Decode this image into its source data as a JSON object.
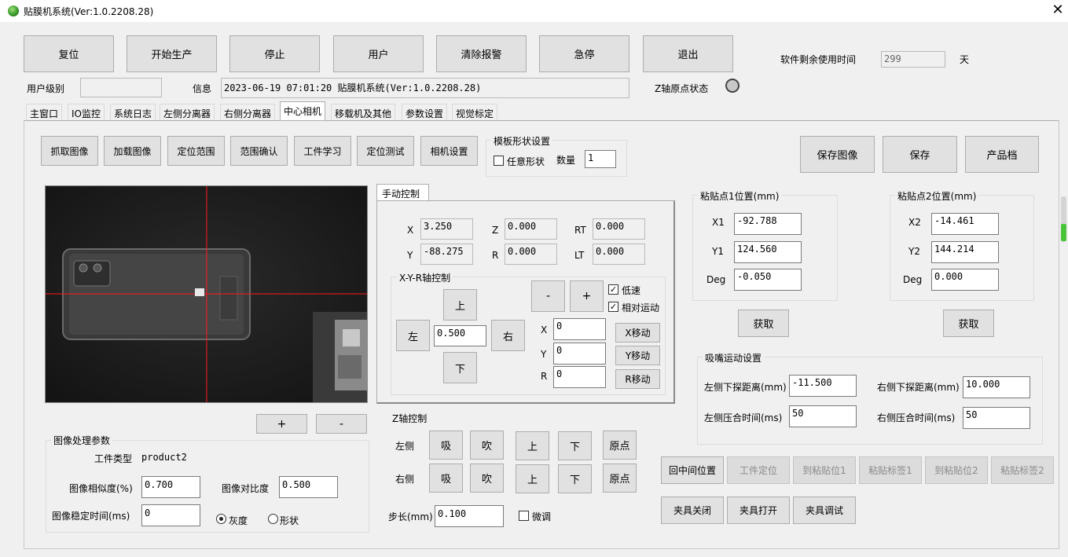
{
  "window": {
    "title": "贴膜机系统(Ver:1.0.2208.28)",
    "close": "✕"
  },
  "toolbar": {
    "buttons": [
      "复位",
      "开始生产",
      "停止",
      "用户",
      "清除报警",
      "急停",
      "退出"
    ],
    "remaining_label": "软件剩余使用时间",
    "remaining_value": "299",
    "remaining_unit": "天"
  },
  "status": {
    "user_level_label": "用户级别",
    "user_level_value": "",
    "info_label": "信息",
    "info_value": "2023-06-19 07:01:20 贴膜机系统(Ver:1.0.2208.28)",
    "z_home_label": "Z轴原点状态"
  },
  "tabs": [
    "主窗口",
    "IO监控",
    "系统日志",
    "左侧分离器",
    "右侧分离器",
    "中心相机",
    "移载机及其他",
    "参数设置",
    "视觉标定"
  ],
  "active_tab_index": 5,
  "camera_buttons": [
    "抓取图像",
    "加载图像",
    "定位范围",
    "范围确认",
    "工件学习",
    "定位测试",
    "相机设置"
  ],
  "template": {
    "title": "模板形状设置",
    "any_shape_label": "任意形状",
    "any_shape_checked": false,
    "count_label": "数量",
    "count_value": "1"
  },
  "right_buttons": [
    "保存图像",
    "保存",
    "产品档"
  ],
  "image_buttons": {
    "plus": "+",
    "minus": "-"
  },
  "image_params": {
    "title": "图像处理参数",
    "workpiece_type_label": "工件类型",
    "workpiece_type_value": "product2",
    "similarity_label": "图像相似度(%)",
    "similarity_value": "0.700",
    "contrast_label": "图像对比度",
    "contrast_value": "0.500",
    "stable_time_label": "图像稳定时间(ms)",
    "stable_time_value": "0",
    "mode_gray": "灰度",
    "mode_shape": "形状",
    "mode_selected": "灰度"
  },
  "manual": {
    "tab": "手动控制",
    "pos": {
      "x_label": "X",
      "x_value": "3.250",
      "y_label": "Y",
      "y_value": "-88.275",
      "z_label": "Z",
      "z_value": "0.000",
      "r_label": "R",
      "r_value": "0.000",
      "rt_label": "RT",
      "rt_value": "0.000",
      "lt_label": "LT",
      "lt_value": "0.000"
    },
    "xyr": {
      "title": "X-Y-R轴控制",
      "up": "上",
      "down": "下",
      "left": "左",
      "right": "右",
      "step_value": "0.500",
      "minus": "-",
      "plus": "+",
      "low_speed": "低速",
      "low_speed_checked": true,
      "relative": "相对运动",
      "relative_checked": true,
      "x_label": "X",
      "x_value": "0",
      "x_move": "X移动",
      "y_label": "Y",
      "y_value": "0",
      "y_move": "Y移动",
      "r_label": "R",
      "r_value": "0",
      "r_move": "R移动"
    }
  },
  "z_control": {
    "title": "Z轴控制",
    "left_label": "左侧",
    "right_label": "右侧",
    "suck": "吸",
    "blow": "吹",
    "up": "上",
    "down": "下",
    "home": "原点",
    "step_label": "步长(mm)",
    "step_value": "0.100",
    "fine_label": "微调",
    "fine_checked": false
  },
  "paste1": {
    "title": "粘贴点1位置(mm)",
    "x_label": "X1",
    "x_value": "-92.788",
    "y_label": "Y1",
    "y_value": "124.560",
    "deg_label": "Deg",
    "deg_value": "-0.050",
    "get": "获取"
  },
  "paste2": {
    "title": "粘贴点2位置(mm)",
    "x_label": "X2",
    "x_value": "-14.461",
    "y_label": "Y2",
    "y_value": "144.214",
    "deg_label": "Deg",
    "deg_value": "0.000",
    "get": "获取"
  },
  "nozzle": {
    "title": "吸嘴运动设置",
    "left_down_label": "左侧下探距离(mm)",
    "left_down_value": "-11.500",
    "right_down_label": "右侧下探距离(mm)",
    "right_down_value": "10.000",
    "left_press_label": "左侧压合时间(ms)",
    "left_press_value": "50",
    "right_press_label": "右侧压合时间(ms)",
    "right_press_value": "50"
  },
  "action_buttons": [
    "回中间位置",
    "工件定位",
    "到粘贴位1",
    "粘贴标签1",
    "到粘贴位2",
    "粘贴标签2"
  ],
  "fixture_buttons": [
    "夹具关闭",
    "夹具打开",
    "夹具调试"
  ]
}
